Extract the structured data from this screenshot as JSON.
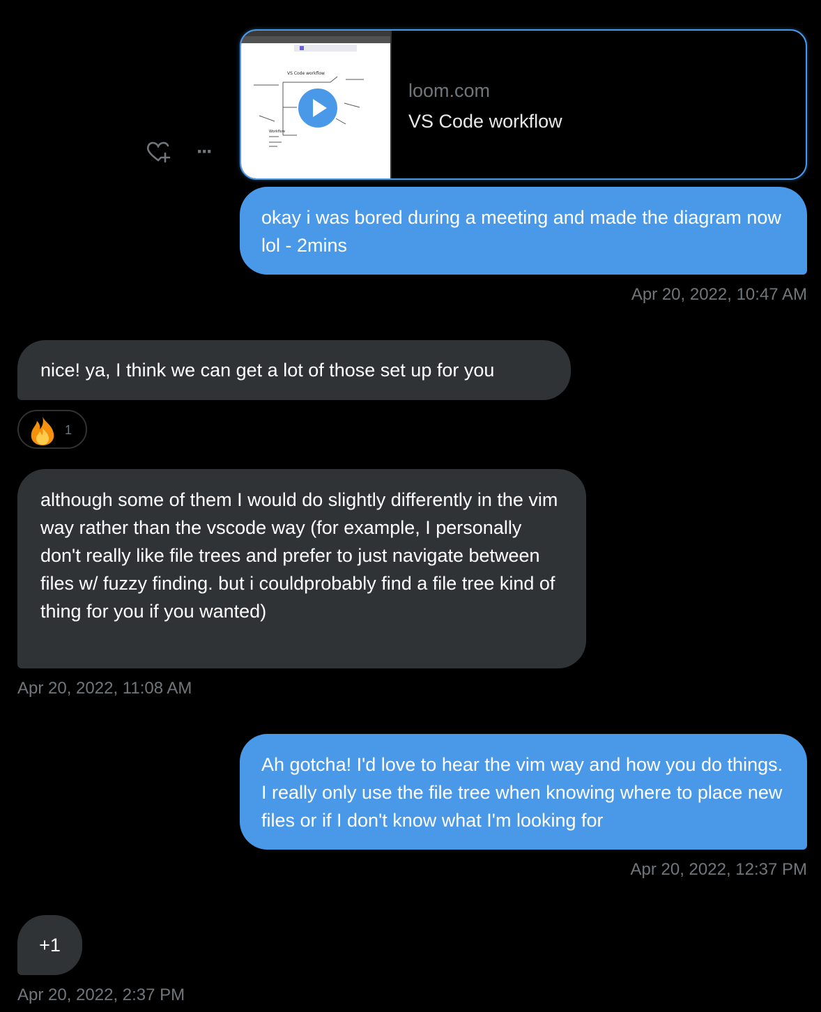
{
  "link_card": {
    "domain": "loom.com",
    "title": "VS Code workflow",
    "thumbnail_heading": "VS Code workflow",
    "thumbnail_subheading": "Workflow"
  },
  "actions": {
    "react_icon": "heart-plus-icon",
    "more_icon": "more-horizontal-icon",
    "more_glyph": "···"
  },
  "messages": [
    {
      "direction": "sent",
      "text": "okay i was bored during a meeting and made the diagram now lol - 2mins",
      "timestamp": "Apr 20, 2022, 10:47 AM"
    },
    {
      "direction": "received",
      "text": "nice! ya, I think we can get a lot of those set up for you",
      "reaction": {
        "emoji": "fire-icon",
        "count": "1"
      }
    },
    {
      "direction": "received",
      "text": "although some of them I would do slightly differently in the vim way rather than the vscode way (for example, I personally don't really like file trees and prefer to just navigate between files w/ fuzzy finding. but i couldprobably find a file tree kind of thing for you if you wanted)",
      "timestamp": "Apr 20, 2022, 11:08 AM"
    },
    {
      "direction": "sent",
      "text": "Ah gotcha! I'd love to hear the vim way and how you do things. I really only use the file tree when knowing where to place new files or if I don't know what I'm looking for",
      "timestamp": "Apr 20, 2022, 12:37 PM"
    },
    {
      "direction": "received",
      "text": "+1",
      "timestamp": "Apr 20, 2022, 2:37 PM"
    }
  ],
  "colors": {
    "background": "#000000",
    "sent_bubble": "#4a99e9",
    "received_bubble": "#2f3336",
    "timestamp": "#71767b"
  }
}
